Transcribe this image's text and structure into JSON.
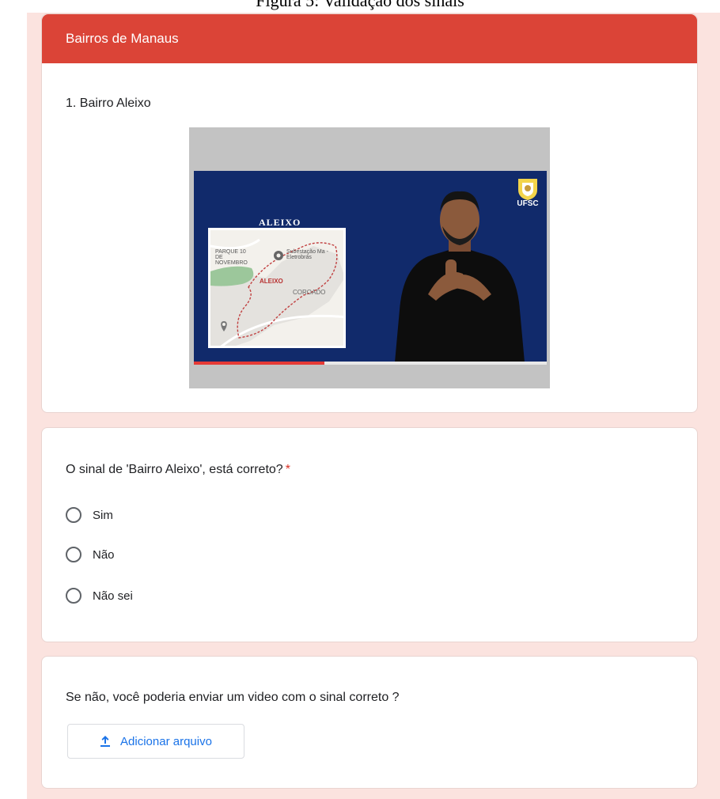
{
  "figure_caption": "Figura 5: Validação dos sinais",
  "section": {
    "title": "Bairros de Manaus"
  },
  "question1": {
    "title": "1. Bairro Aleixo",
    "video": {
      "map_title": "ALEIXO",
      "map_labels": {
        "parque": "PARQUE 10 DE NOVEMBRO",
        "subestacao": "Subestação Ma - Eletrobrás",
        "aleixo": "ALEIXO",
        "coroado": "COROADO"
      },
      "logo_text": "UFSC",
      "progress_fraction": 0.37
    }
  },
  "question2": {
    "title": "O sinal de 'Bairro Aleixo', está correto?",
    "required_mark": "*",
    "options": [
      "Sim",
      "Não",
      "Não sei"
    ]
  },
  "question3": {
    "title": "Se não, você poderia enviar um video com o sinal correto ?",
    "upload_label": "Adicionar arquivo",
    "upload_icon": "upload-icon"
  },
  "colors": {
    "header": "#db4437",
    "page_background": "#fbe3df",
    "accent": "#1a73e8",
    "required": "#d93025",
    "video_background": "#112a6b"
  }
}
